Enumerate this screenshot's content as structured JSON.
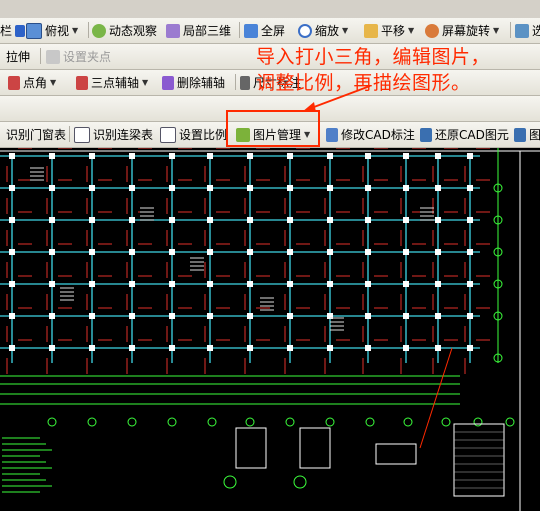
{
  "toolbar1": {
    "items": [
      {
        "label": "俯视",
        "icon": "cube-icon"
      },
      {
        "label": "动态观察",
        "icon": "orbit-icon"
      },
      {
        "label": "局部三维",
        "icon": "local-3d-icon"
      },
      {
        "label": "全屏",
        "icon": "fullscreen-icon"
      },
      {
        "label": "缩放",
        "icon": "zoom-icon"
      },
      {
        "label": "平移",
        "icon": "pan-icon"
      },
      {
        "label": "屏幕旋转",
        "icon": "rotate-screen-icon"
      },
      {
        "label": "选",
        "icon": "select-icon"
      }
    ],
    "left_fragment": "栏"
  },
  "toolbar2": {
    "stretch_label": "拉伸",
    "grip_label": "设置夹点"
  },
  "toolbar3": {
    "point_angle_label": "点角",
    "three_point_axis_label": "三点辅轴",
    "delete_axis_label": "删除辅轴",
    "dimension_label": "尺寸标注"
  },
  "toolbar4": {
    "items": [
      {
        "label": "识别门窗表",
        "icon": "door-window-table-icon"
      },
      {
        "label": "识别连梁表",
        "icon": "beam-table-icon"
      },
      {
        "label": "设置比例",
        "icon": "scale-icon"
      },
      {
        "label": "图片管理",
        "icon": "image-manage-icon"
      },
      {
        "label": "修改CAD标注",
        "icon": "edit-cad-icon"
      },
      {
        "label": "还原CAD图元",
        "icon": "restore-cad-icon"
      },
      {
        "label": "图",
        "icon": "figure-icon"
      }
    ]
  },
  "annotation": {
    "line1": "导入打小三角，编辑图片，",
    "line2": "调整比例，再描绘图形。",
    "color": "#ff2a00"
  },
  "colors": {
    "cad_background": "#000000",
    "axis_cyan": "#3fd6e6",
    "column_white": "#ffffff",
    "rebar_red": "#e0302a",
    "dim_green": "#3cff3c"
  }
}
